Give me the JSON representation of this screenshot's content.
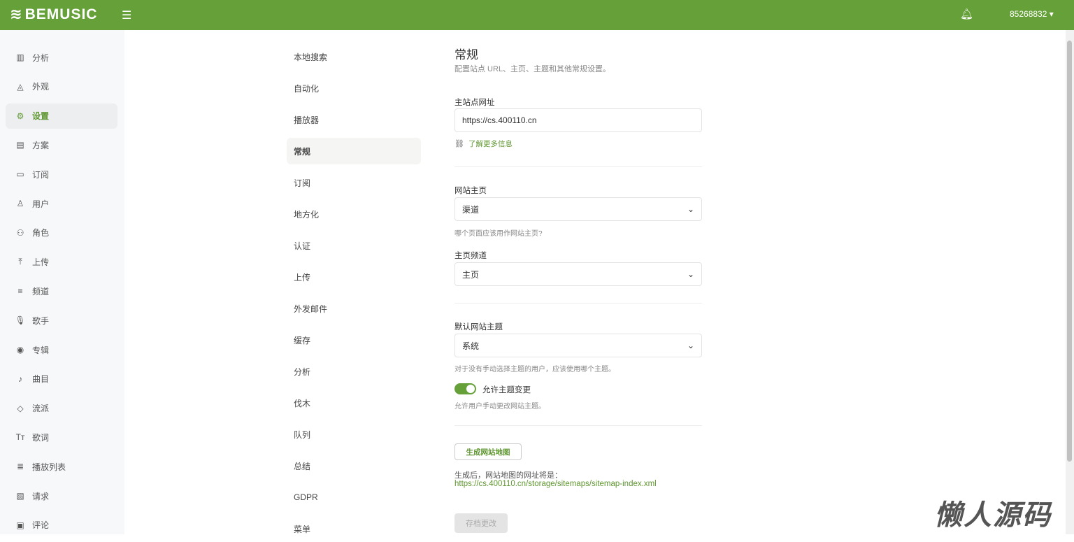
{
  "header": {
    "logo": "BEMUSIC",
    "username": "85268832"
  },
  "sidebar": {
    "items": [
      {
        "label": "分析",
        "icon": "chart-icon"
      },
      {
        "label": "外观",
        "icon": "appearance-icon"
      },
      {
        "label": "设置",
        "icon": "gear-icon",
        "active": true
      },
      {
        "label": "方案",
        "icon": "clipboard-icon"
      },
      {
        "label": "订阅",
        "icon": "subscription-icon"
      },
      {
        "label": "用户",
        "icon": "user-icon"
      },
      {
        "label": "角色",
        "icon": "roles-icon"
      },
      {
        "label": "上传",
        "icon": "upload-icon"
      },
      {
        "label": "频道",
        "icon": "channel-icon"
      },
      {
        "label": "歌手",
        "icon": "mic-icon"
      },
      {
        "label": "专辑",
        "icon": "album-icon"
      },
      {
        "label": "曲目",
        "icon": "music-note-icon"
      },
      {
        "label": "流派",
        "icon": "tag-icon"
      },
      {
        "label": "歌词",
        "icon": "text-icon"
      },
      {
        "label": "播放列表",
        "icon": "playlist-icon"
      },
      {
        "label": "请求",
        "icon": "request-icon"
      },
      {
        "label": "评论",
        "icon": "comment-icon"
      }
    ]
  },
  "subnav": {
    "items": [
      "本地搜索",
      "自动化",
      "播放器",
      "常规",
      "订阅",
      "地方化",
      "认证",
      "上传",
      "外发邮件",
      "缓存",
      "分析",
      "伐木",
      "队列",
      "总结",
      "GDPR",
      "菜单"
    ],
    "active": 3
  },
  "main": {
    "title": "常规",
    "description": "配置站点 URL、主页、主题和其他常规设置。",
    "site_url_label": "主站点网址",
    "site_url_value": "https://cs.400110.cn",
    "learn_more": "了解更多信息",
    "homepage_label": "网站主页",
    "homepage_value": "渠道",
    "homepage_hint": "哪个页面应该用作网站主页?",
    "channel_label": "主页频道",
    "channel_value": "主页",
    "theme_label": "默认网站主题",
    "theme_value": "系统",
    "theme_hint": "对于没有手动选择主题的用户，应该使用哪个主题。",
    "toggle_label": "允许主题变更",
    "toggle_on": true,
    "toggle_hint": "允许用户手动更改网站主题。",
    "sitemap_button": "生成网站地图",
    "sitemap_note": "生成后，网站地图的网址将是：",
    "sitemap_url": "https://cs.400110.cn/storage/sitemaps/sitemap-index.xml",
    "save_button": "存档更改"
  },
  "watermark": "懒人源码",
  "colors": {
    "brand": "#66a039"
  }
}
